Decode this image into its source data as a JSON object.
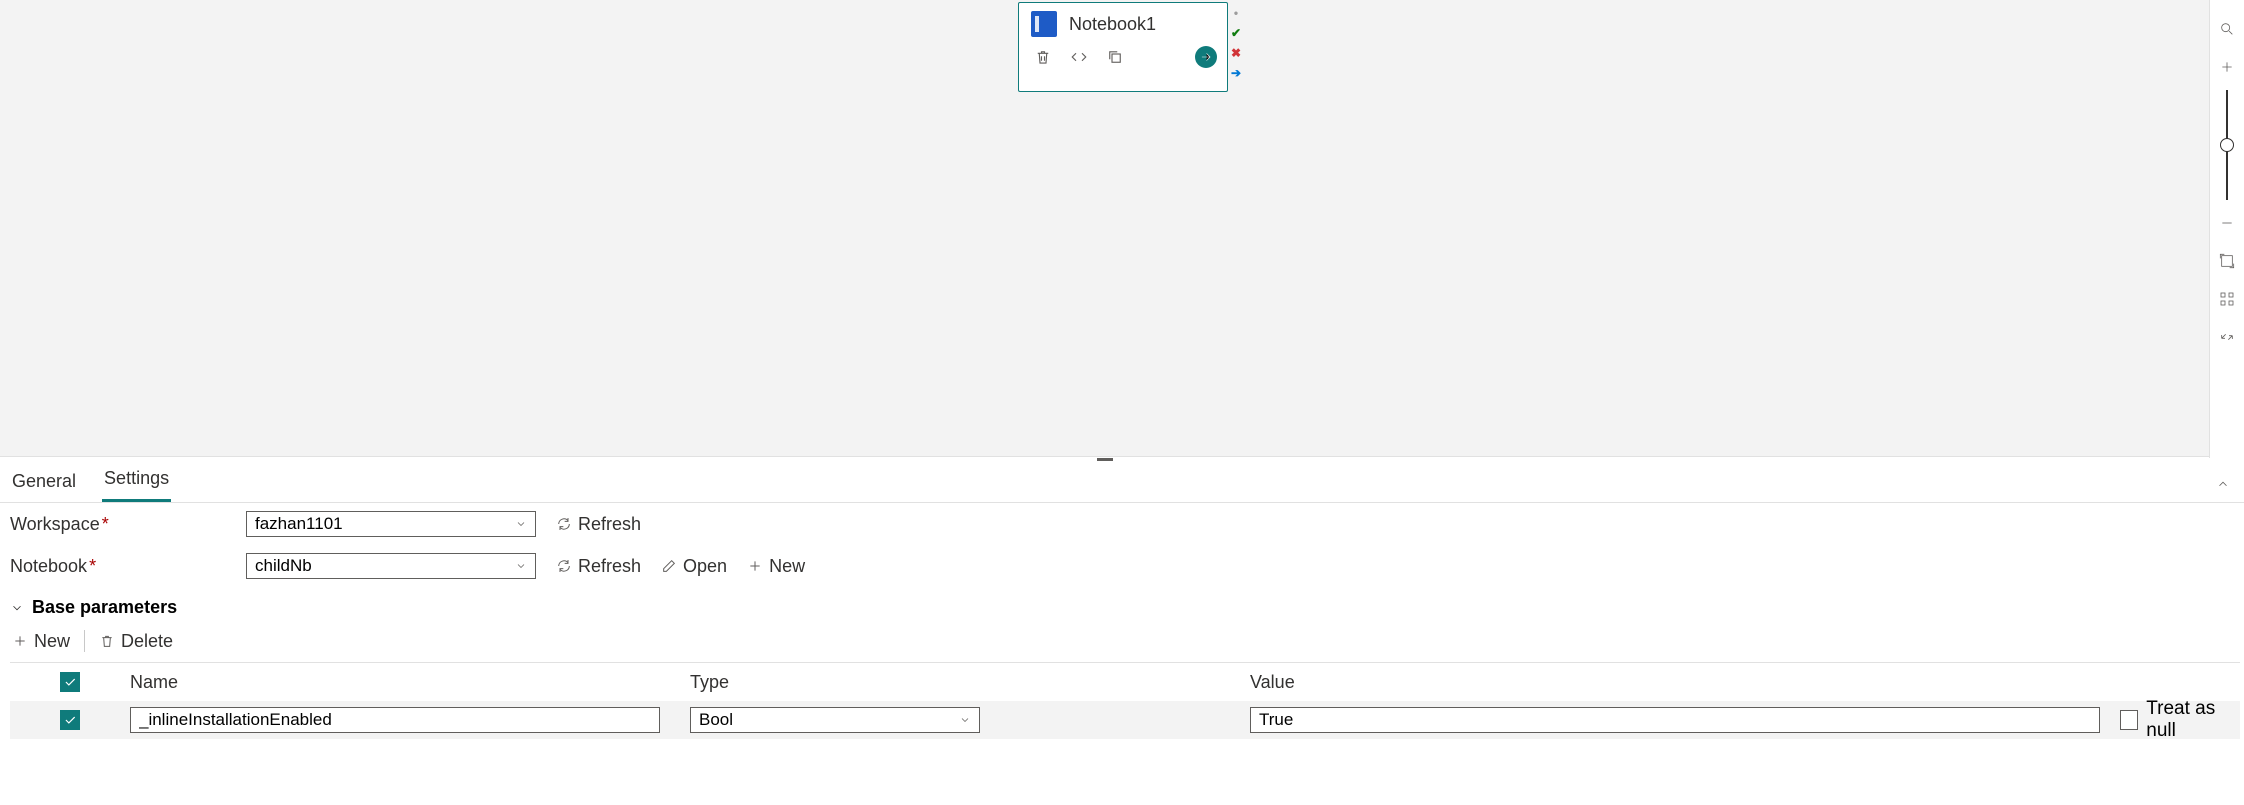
{
  "node": {
    "title": "Notebook1"
  },
  "panel": {
    "tabs": {
      "general": "General",
      "settings": "Settings"
    },
    "workspace": {
      "label": "Workspace",
      "value": "fazhan1101",
      "refresh": "Refresh"
    },
    "notebook": {
      "label": "Notebook",
      "value": "childNb",
      "refresh": "Refresh",
      "open": "Open",
      "new": "New"
    },
    "baseParams": {
      "header": "Base parameters",
      "new": "New",
      "delete": "Delete",
      "columns": {
        "name": "Name",
        "type": "Type",
        "value": "Value",
        "null": "Treat as null"
      },
      "rows": [
        {
          "name": "_inlineInstallationEnabled",
          "type": "Bool",
          "value": "True"
        }
      ]
    }
  }
}
